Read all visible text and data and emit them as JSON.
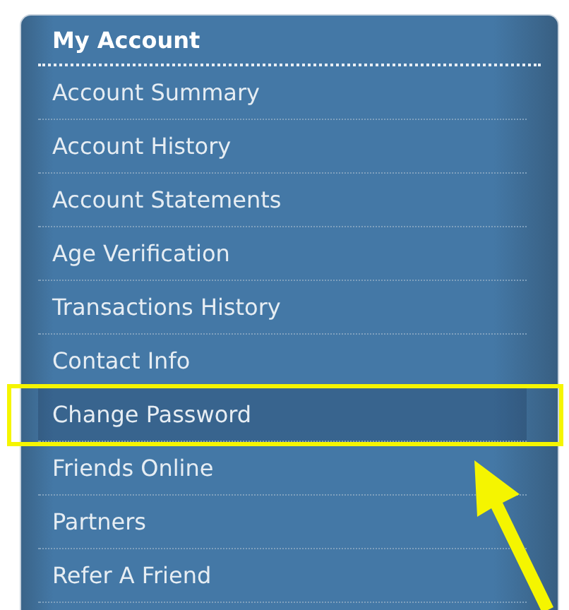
{
  "menu": {
    "title": "My Account",
    "items": [
      {
        "label": "Account Summary",
        "highlighted": false
      },
      {
        "label": "Account History",
        "highlighted": false
      },
      {
        "label": "Account Statements",
        "highlighted": false
      },
      {
        "label": "Age Verification",
        "highlighted": false
      },
      {
        "label": "Transactions History",
        "highlighted": false
      },
      {
        "label": "Contact Info",
        "highlighted": false
      },
      {
        "label": "Change Password",
        "highlighted": true
      },
      {
        "label": "Friends Online",
        "highlighted": false
      },
      {
        "label": "Partners",
        "highlighted": false
      },
      {
        "label": "Refer A Friend",
        "highlighted": false
      }
    ]
  }
}
